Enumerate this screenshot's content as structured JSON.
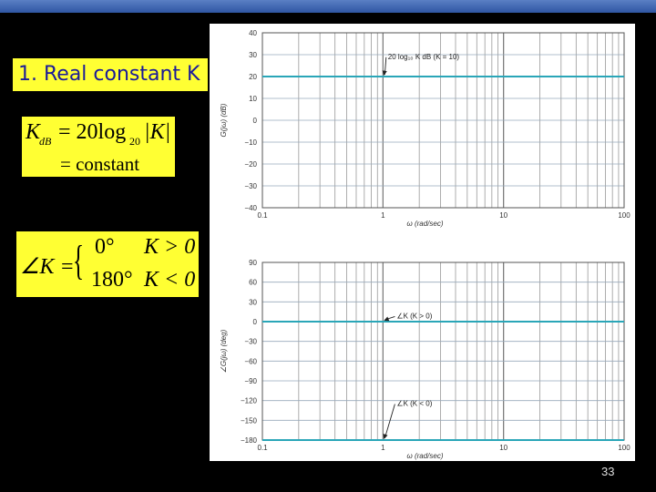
{
  "slide": {
    "heading": "1. Real constant K",
    "number": "33"
  },
  "equation1": {
    "lhs": "K",
    "lhs_sub": "dB",
    "rhs": "= 20log",
    "rhs_sub": "20",
    "abs": "|K|",
    "line2": "= constant"
  },
  "equation2": {
    "lhs": "∠K =",
    "case1_val": "0°",
    "case1_cond": "K > 0",
    "case2_val": "180°",
    "case2_cond": "K < 0"
  },
  "chart_data": [
    {
      "type": "line",
      "x_scale": "log",
      "xlim": [
        0.1,
        100
      ],
      "x_ticks": [
        "0.1",
        "1",
        "10",
        "100"
      ],
      "xlabel": "ω (rad/sec)",
      "ylabel": "G(jω) (dB)",
      "ylim": [
        -40,
        40
      ],
      "y_ticks": [
        40,
        30,
        20,
        10,
        0,
        -10,
        -20,
        -30,
        -40
      ],
      "grid": true,
      "series": [
        {
          "x": [
            0.1,
            100
          ],
          "y": [
            20,
            20
          ],
          "color": "#2aa6b8"
        }
      ],
      "annotations": [
        {
          "text": "20 log₁₀ K dB (K = 10)",
          "x": 1.1,
          "y": 28,
          "arrow_to": [
            1.0,
            20
          ]
        }
      ]
    },
    {
      "type": "line",
      "x_scale": "log",
      "xlim": [
        0.1,
        100
      ],
      "x_ticks": [
        "0.1",
        "1",
        "10",
        "100"
      ],
      "xlabel": "ω (rad/sec)",
      "ylabel": "∠G(jω) (deg)",
      "ylim": [
        -180,
        90
      ],
      "y_ticks": [
        90,
        60,
        30,
        0,
        -30,
        -60,
        -90,
        -120,
        -150,
        -180
      ],
      "grid": true,
      "series": [
        {
          "x": [
            0.1,
            100
          ],
          "y": [
            0,
            0
          ],
          "color": "#2aa6b8"
        },
        {
          "x": [
            0.1,
            100
          ],
          "y": [
            -180,
            -180
          ],
          "color": "#2aa6b8"
        }
      ],
      "annotations": [
        {
          "text": "∠K (K > 0)",
          "x": 1.3,
          "y": 5,
          "arrow_to": [
            1.0,
            0
          ]
        },
        {
          "text": "∠K (K < 0)",
          "x": 1.3,
          "y": -128,
          "arrow_to": [
            1.0,
            -180
          ]
        }
      ]
    }
  ]
}
